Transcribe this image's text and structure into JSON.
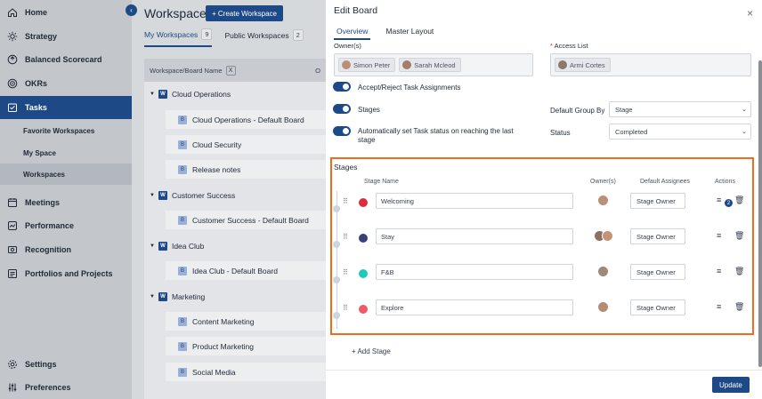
{
  "sidebar": {
    "items": [
      {
        "label": "Home",
        "icon": "home-icon"
      },
      {
        "label": "Strategy",
        "icon": "strategy-icon"
      },
      {
        "label": "Balanced Scorecard",
        "icon": "scorecard-icon"
      },
      {
        "label": "OKRs",
        "icon": "target-icon"
      },
      {
        "label": "Tasks",
        "icon": "tasks-icon"
      },
      {
        "label": "Meetings",
        "icon": "calendar-icon"
      },
      {
        "label": "Performance",
        "icon": "performance-icon"
      },
      {
        "label": "Recognition",
        "icon": "recognition-icon"
      },
      {
        "label": "Portfolios and Projects",
        "icon": "portfolio-icon"
      },
      {
        "label": "Settings",
        "icon": "gear-icon"
      },
      {
        "label": "Preferences",
        "icon": "sliders-icon"
      }
    ],
    "subitems": [
      "Favorite Workspaces",
      "My Space",
      "Workspaces"
    ]
  },
  "main": {
    "title": "Workspaces",
    "create_button": "+ Create Workspace",
    "tabs": [
      {
        "label": "My Workspaces",
        "count": "9"
      },
      {
        "label": "Public Workspaces",
        "count": "2"
      }
    ],
    "table_header": "Workspace/Board Name",
    "table_header_clear": "X",
    "table_header_trailing": "O",
    "workspaces": [
      {
        "name": "Cloud Operations",
        "boards": [
          "Cloud Operations - Default Board",
          "Cloud Security",
          "Release notes"
        ]
      },
      {
        "name": "Customer Success",
        "boards": [
          "Customer Success - Default Board"
        ]
      },
      {
        "name": "Idea Club",
        "boards": [
          "Idea Club - Default Board"
        ]
      },
      {
        "name": "Marketing",
        "boards": [
          "Content Marketing",
          "Product Marketing",
          "Social Media"
        ]
      }
    ],
    "workspace_badge": "W",
    "board_badge": "B"
  },
  "modal": {
    "title": "Edit Board",
    "close": "×",
    "tabs": [
      "Overview",
      "Master Layout"
    ],
    "owners_label": "Owner(s)",
    "owners": [
      "Simon Peter",
      "Sarah Mcleod"
    ],
    "access_label": "Access List",
    "access_required": "*",
    "access": [
      "Armi Cortes"
    ],
    "toggles": [
      "Accept/Reject Task Assignments",
      "Stages",
      "Automatically set Task status on reaching the last stage"
    ],
    "group_by_label": "Default Group By",
    "group_by_value": "Stage",
    "status_label": "Status",
    "status_value": "Completed",
    "stages": {
      "title": "Stages",
      "col_stage_name": "Stage Name",
      "col_owners": "Owner(s)",
      "col_assignees": "Default Assignees",
      "col_actions": "Actions",
      "rows": [
        {
          "name": "Welcoming",
          "color": "#dc2e3a",
          "assignee": "Stage Owner",
          "badge": "2"
        },
        {
          "name": "Stay",
          "color": "#3b3f7a",
          "assignee": "Stage Owner"
        },
        {
          "name": "F&B",
          "color": "#1ec9b7",
          "assignee": "Stage Owner"
        },
        {
          "name": "Explore",
          "color": "#ef5b66",
          "assignee": "Stage Owner"
        }
      ]
    },
    "add_stage": "+ Add Stage",
    "update_button": "Update"
  },
  "colors": {
    "accent": "#1d4a86",
    "highlight": "#ef6c1e"
  }
}
